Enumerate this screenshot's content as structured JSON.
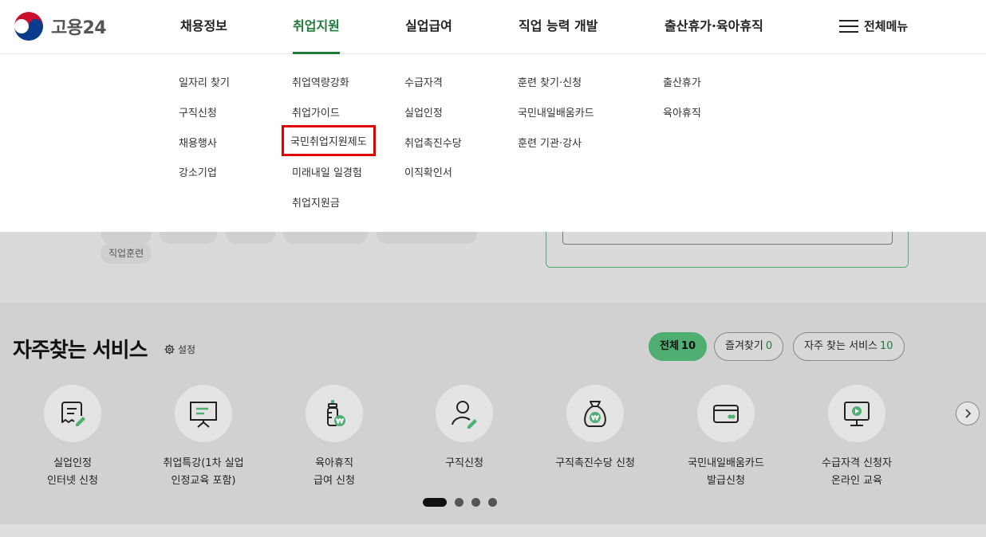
{
  "header": {
    "logo_text": "고용24",
    "nav": [
      "채용정보",
      "취업지원",
      "실업급여",
      "직업 능력 개발",
      "출산휴가·육아휴직"
    ],
    "all_menu_label": "전체메뉴"
  },
  "dropdown": {
    "col1": [
      "일자리 찾기",
      "구직신청",
      "채용행사",
      "강소기업"
    ],
    "col2": [
      "취업역량강화",
      "취업가이드",
      "국민취업지원제도",
      "미래내일 일경험",
      "취업지원금"
    ],
    "col3": [
      "수급자격",
      "실업인정",
      "취업촉진수당",
      "이직확인서"
    ],
    "col4": [
      "훈련 찾기·신청",
      "국민내일배움카드",
      "훈련 기관·강사"
    ],
    "col5": [
      "출산휴가",
      "육아휴직"
    ]
  },
  "background": {
    "tag_visible": "직업훈련"
  },
  "services": {
    "title": "자주찾는 서비스",
    "settings_label": "설정",
    "filters": [
      {
        "label": "전체",
        "count": "10"
      },
      {
        "label": "즐겨찾기",
        "count": "0"
      },
      {
        "label": "자주 찾는 서비스",
        "count": "10"
      }
    ],
    "cards": [
      {
        "line1": "실업인정",
        "line2": "인터넷 신청",
        "icon": "document-pen-icon"
      },
      {
        "line1": "취업특강(1차 실업",
        "line2": "인정교육 포함)",
        "icon": "presentation-board-icon"
      },
      {
        "line1": "육아휴직",
        "line2": "급여 신청",
        "icon": "baby-bottle-icon"
      },
      {
        "line1": "구직신청",
        "line2": "",
        "icon": "person-pen-icon"
      },
      {
        "line1": "구직촉진수당 신청",
        "line2": "",
        "icon": "money-bag-icon"
      },
      {
        "line1": "국민내일배움카드",
        "line2": "발급신청",
        "icon": "card-icon"
      },
      {
        "line1": "수급자격 신청자",
        "line2": "온라인 교육",
        "icon": "monitor-play-icon"
      }
    ]
  },
  "colors": {
    "brand_green": "#1f7a3c",
    "active_filter": "#4fae72",
    "highlight_box": "#e00000"
  }
}
